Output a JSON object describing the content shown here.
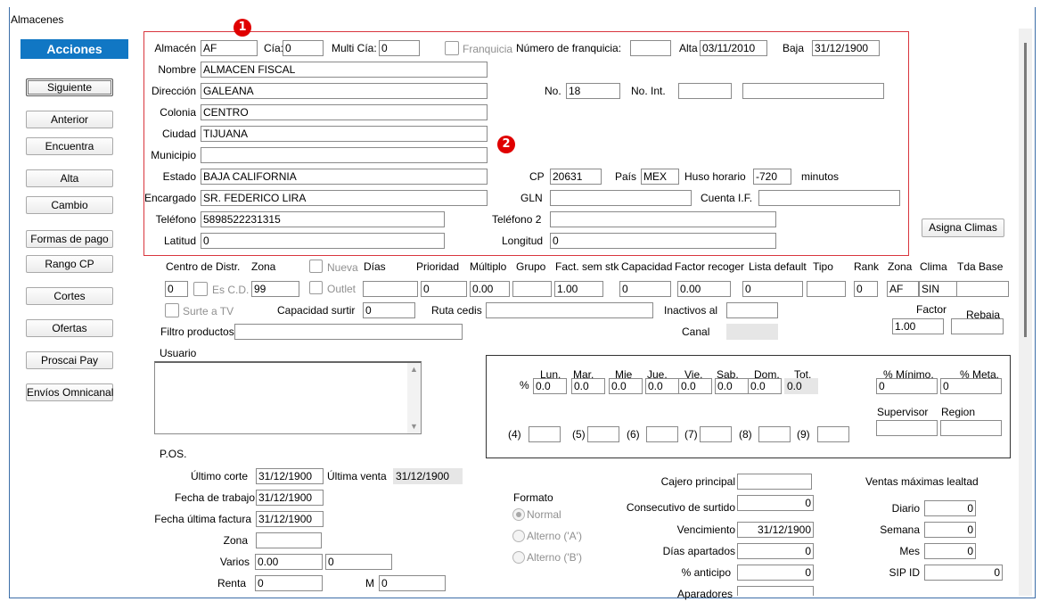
{
  "window": {
    "title": "Almacenes"
  },
  "sidebar": {
    "header": "Acciones",
    "buttons": [
      "Siguiente",
      "Anterior",
      "Encuentra",
      "Alta",
      "Cambio",
      "Formas de pago",
      "Rango CP",
      "Cortes",
      "Ofertas",
      "Proscai Pay",
      "Envíos Omnicanal"
    ]
  },
  "badges": [
    "1",
    "2"
  ],
  "general": {
    "almacen": {
      "label": "Almacén",
      "value": "AF"
    },
    "cia": {
      "label": "Cía:",
      "value": "0"
    },
    "multi_cia": {
      "label": "Multi Cía:",
      "value": "0"
    },
    "franquicia": {
      "label": "Franquicia",
      "checked": false
    },
    "numero_franquicia": {
      "label": "Número de franquicia:",
      "value": ""
    },
    "alta": {
      "label": "Alta",
      "value": "03/11/2010"
    },
    "baja": {
      "label": "Baja",
      "value": "31/12/1900"
    },
    "nombre": {
      "label": "Nombre",
      "value": "ALMACEN FISCAL"
    },
    "direccion": {
      "label": "Dirección",
      "value": "GALEANA"
    },
    "no": {
      "label": "No.",
      "value": "18"
    },
    "no_int": {
      "label": "No. Int.",
      "value": "",
      "extra": ""
    },
    "colonia": {
      "label": "Colonia",
      "value": "CENTRO"
    },
    "ciudad": {
      "label": "Ciudad",
      "value": "TIJUANA"
    },
    "municipio": {
      "label": "Municipio",
      "value": ""
    },
    "estado": {
      "label": "Estado",
      "value": "BAJA CALIFORNIA"
    },
    "cp": {
      "label": "CP",
      "value": "20631"
    },
    "pais": {
      "label": "País",
      "value": "MEX"
    },
    "huso": {
      "label": "Huso horario",
      "value": "-720",
      "unit": "minutos"
    },
    "encargado": {
      "label": "Encargado",
      "value": "SR. FEDERICO LIRA"
    },
    "gln": {
      "label": "GLN",
      "value": ""
    },
    "cuenta_if": {
      "label": "Cuenta I.F.",
      "value": ""
    },
    "telefono": {
      "label": "Teléfono",
      "value": "5898522231315"
    },
    "telefono2": {
      "label": "Teléfono 2",
      "value": ""
    },
    "latitud": {
      "label": "Latitud",
      "value": "0"
    },
    "longitud": {
      "label": "Longitud",
      "value": "0"
    }
  },
  "asigna_climas": "Asigna Climas",
  "dist": {
    "headers": {
      "centro": "Centro de Distr.",
      "zona": "Zona",
      "nueva": "Nueva",
      "dias": "Días",
      "prioridad": "Prioridad",
      "multiplo": "Múltiplo",
      "grupo": "Grupo",
      "fact_sem": "Fact. sem stk",
      "capacidad": "Capacidad",
      "factor_recoger": "Factor recoger",
      "lista_default": "Lista default",
      "tipo": "Tipo",
      "rank": "Rank",
      "zona2": "Zona",
      "clima": "Clima",
      "tda_base": "Tda Base"
    },
    "values": {
      "centro": "0",
      "es_cd": "Es C.D.",
      "zona": "99",
      "outlet": "Outlet",
      "dias": "",
      "prioridad": "0",
      "multiplo": "0.00",
      "grupo": "",
      "fact_sem": "1.00",
      "capacidad": "0",
      "factor_recoger": "0.00",
      "lista_default": "0",
      "tipo": "",
      "rank": "0",
      "zona2": "AF",
      "clima": "SIN",
      "tda_base": ""
    },
    "surte_tv": "Surte a TV",
    "capacidad_surtir": {
      "label": "Capacidad surtir",
      "value": "0"
    },
    "ruta_cedis": {
      "label": "Ruta cedis",
      "value": ""
    },
    "inactivos_al": {
      "label": "Inactivos al",
      "value": ""
    },
    "factor": {
      "label": "Factor",
      "value": "1.00"
    },
    "rebaja": {
      "label": "Rebaja",
      "value": ""
    },
    "filtro": {
      "label": "Filtro productos",
      "value": ""
    },
    "canal": {
      "label": "Canal",
      "value": ""
    },
    "usuario": {
      "label": "Usuario",
      "value": ""
    }
  },
  "weekly": {
    "pct": "%",
    "days": [
      "Lun.",
      "Mar.",
      "Mie",
      "Jue.",
      "Vie.",
      "Sab.",
      "Dom.",
      "Tot."
    ],
    "values": [
      "0.0",
      "0.0",
      "0.0",
      "0.0",
      "0.0",
      "0.0",
      "0.0",
      "0.0"
    ],
    "pct_minimo": {
      "label": "% Mínimo.",
      "value": "0"
    },
    "pct_meta": {
      "label": "% Meta.",
      "value": "0"
    },
    "numbered": [
      "(4)",
      "(5)",
      "(6)",
      "(7)",
      "(8)",
      "(9)"
    ],
    "supervisor": {
      "label": "Supervisor",
      "value": ""
    },
    "region": {
      "label": "Region",
      "value": ""
    }
  },
  "pos": {
    "title": "P.OS.",
    "ultimo_corte": {
      "label": "Último corte",
      "value": "31/12/1900"
    },
    "ultima_venta": {
      "label": "Última venta",
      "value": "31/12/1900"
    },
    "fecha_trabajo": {
      "label": "Fecha de trabajo",
      "value": "31/12/1900"
    },
    "fecha_factura": {
      "label": "Fecha última factura",
      "value": "31/12/1900"
    },
    "zona": {
      "label": "Zona",
      "value": ""
    },
    "varios": {
      "label": "Varios",
      "value1": "0.00",
      "value2": "0"
    },
    "renta": {
      "label": "Renta",
      "value": "0"
    },
    "m": {
      "label": "M",
      "value": "0"
    }
  },
  "formato": {
    "title": "Formato",
    "options": [
      "Normal",
      "Alterno ('A')",
      "Alterno ('B')"
    ],
    "selected": "Normal"
  },
  "cajero": {
    "cajero_principal": {
      "label": "Cajero principal",
      "value": ""
    },
    "consecutivo": {
      "label": "Consecutivo de surtido",
      "value": "0"
    },
    "vencimiento": {
      "label": "Vencimiento",
      "value": "31/12/1900"
    },
    "dias_apartados": {
      "label": "Días apartados",
      "value": "0"
    },
    "pct_anticipo": {
      "label": "% anticipo",
      "value": "0"
    },
    "aparadores": {
      "label": "Aparadores",
      "value": ""
    }
  },
  "lealtad": {
    "title": "Ventas máximas lealtad",
    "diario": {
      "label": "Diario",
      "value": "0"
    },
    "semana": {
      "label": "Semana",
      "value": "0"
    },
    "mes": {
      "label": "Mes",
      "value": "0"
    },
    "sip_id": {
      "label": "SIP ID",
      "value": "0"
    }
  },
  "colors": {
    "accent": "#1177c4",
    "badge": "#e00000",
    "highlight_border": "#d9363e",
    "window_border": "#3c6ea8"
  }
}
